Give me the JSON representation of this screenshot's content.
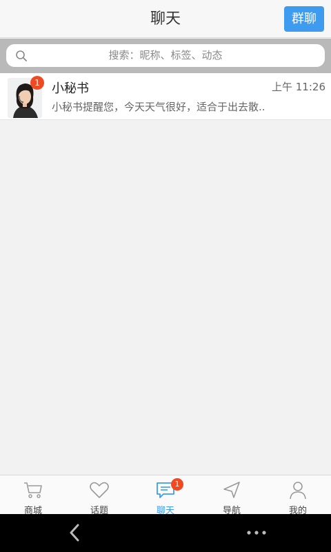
{
  "header": {
    "title": "聊天",
    "group_chat_label": "群聊"
  },
  "search": {
    "placeholder": "搜索：昵称、标签、动态"
  },
  "chats": [
    {
      "name": "小秘书",
      "time": "上午 11:26",
      "message": "小秘书提醒您，今天天气很好，适合于出去散..",
      "unread": "1",
      "avatar_icon": "woman-headset-avatar"
    }
  ],
  "tabbar": {
    "tabs": [
      {
        "label": "商城",
        "icon": "cart-icon"
      },
      {
        "label": "话题",
        "icon": "heart-icon"
      },
      {
        "label": "聊天",
        "icon": "chat-icon",
        "badge": "1",
        "active": true
      },
      {
        "label": "导航",
        "icon": "navigation-icon"
      },
      {
        "label": "我的",
        "icon": "user-icon"
      }
    ]
  },
  "colors": {
    "accent": "#3d9bf0",
    "badge": "#f04a23"
  }
}
